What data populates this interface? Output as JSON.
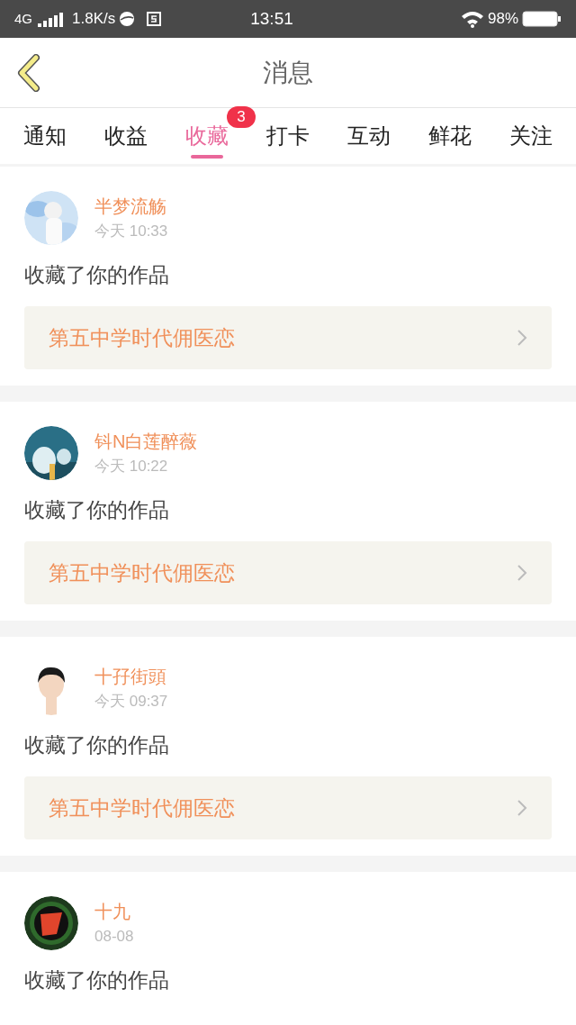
{
  "status_bar": {
    "network": "4G",
    "speed": "1.8K/s",
    "time": "13:51",
    "battery": "98%"
  },
  "header": {
    "title": "消息"
  },
  "tabs": [
    {
      "label": "通知",
      "selected": false
    },
    {
      "label": "收益",
      "selected": false
    },
    {
      "label": "收藏",
      "selected": true,
      "badge": "3"
    },
    {
      "label": "打卡",
      "selected": false
    },
    {
      "label": "互动",
      "selected": false
    },
    {
      "label": "鲜花",
      "selected": false
    },
    {
      "label": "关注",
      "selected": false
    }
  ],
  "messages": [
    {
      "user": "半梦流觞",
      "time": "今天 10:33",
      "text": "收藏了你的作品",
      "book": "第五中学时代佣医恋"
    },
    {
      "user": "钭N白莲醉薇",
      "time": "今天 10:22",
      "text": "收藏了你的作品",
      "book": "第五中学时代佣医恋"
    },
    {
      "user": "十孖街頭",
      "time": "今天 09:37",
      "text": "收藏了你的作品",
      "book": "第五中学时代佣医恋"
    },
    {
      "user": "十九",
      "time": "08-08",
      "text": "收藏了你的作品"
    }
  ]
}
